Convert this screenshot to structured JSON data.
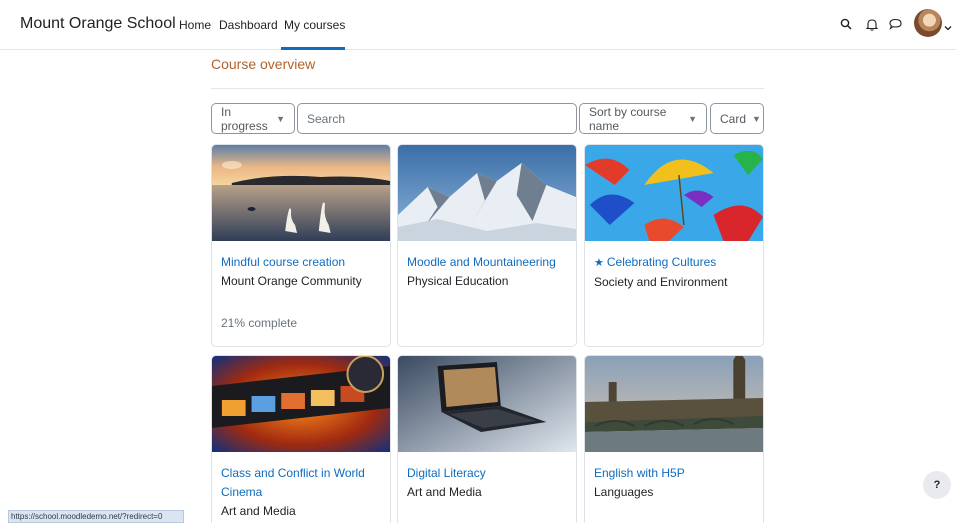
{
  "navbar": {
    "brand": "Mount Orange School",
    "links": [
      "Home",
      "Dashboard",
      "My courses"
    ],
    "active_link": "My courses",
    "icons": [
      "search-icon",
      "bell-icon",
      "chat-icon",
      "avatar",
      "chevron-down-icon"
    ]
  },
  "page": {
    "title": "Course overview"
  },
  "filters": {
    "status": "In progress",
    "search_placeholder": "Search",
    "sort": "Sort by course name",
    "view": "Card"
  },
  "courses": [
    {
      "name": "Mindful course creation",
      "category": "Mount Orange Community",
      "progress": "21% complete",
      "starred": false
    },
    {
      "name": "Moodle and Mountaineering",
      "category": "Physical Education",
      "starred": false
    },
    {
      "name": "Celebrating Cultures",
      "category": "Society and Environment",
      "starred": true
    },
    {
      "name": "Class and Conflict in World Cinema",
      "category": "Art and Media",
      "starred": false
    },
    {
      "name": "Digital Literacy",
      "category": "Art and Media",
      "starred": false
    },
    {
      "name": "English with H5P",
      "category": "Languages",
      "starred": false
    }
  ],
  "status_bar": {
    "url": "https://school.moodledemo.net/?redirect=0"
  },
  "help": {
    "label": "?"
  },
  "colors": {
    "link": "#0f6cbf",
    "title": "#b2622a",
    "text": "#1d2125"
  }
}
